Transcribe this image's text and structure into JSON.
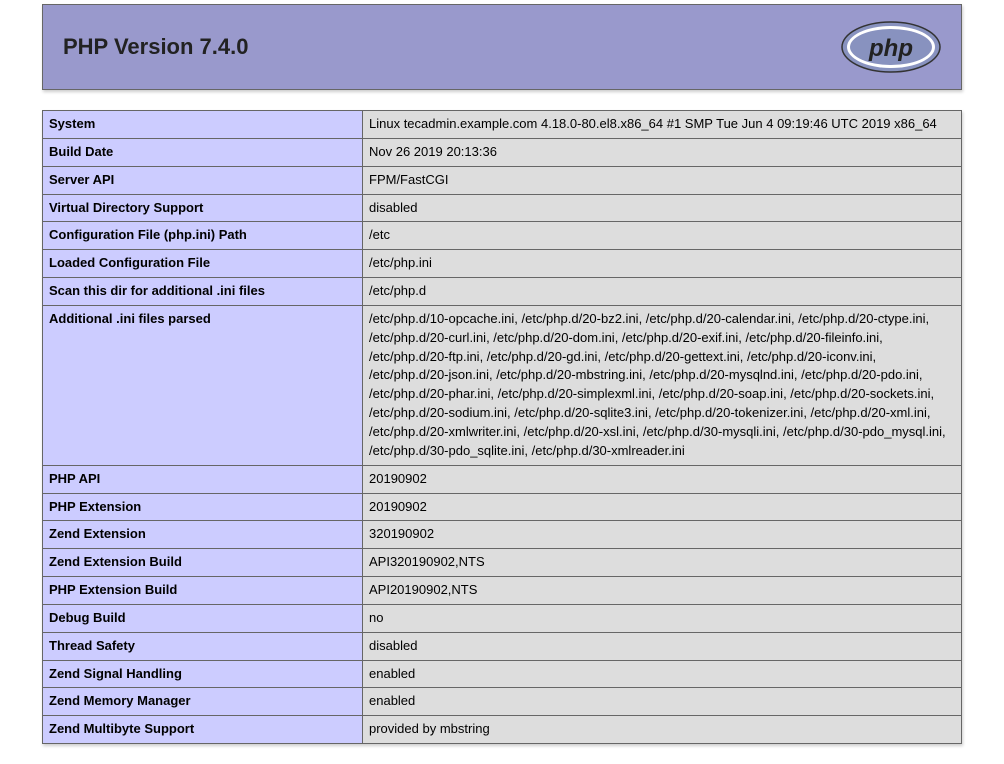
{
  "header": {
    "title": "PHP Version 7.4.0"
  },
  "rows": [
    {
      "label": "System",
      "value": "Linux tecadmin.example.com 4.18.0-80.el8.x86_64 #1 SMP Tue Jun 4 09:19:46 UTC 2019 x86_64"
    },
    {
      "label": "Build Date",
      "value": "Nov 26 2019 20:13:36"
    },
    {
      "label": "Server API",
      "value": "FPM/FastCGI"
    },
    {
      "label": "Virtual Directory Support",
      "value": "disabled"
    },
    {
      "label": "Configuration File (php.ini) Path",
      "value": "/etc"
    },
    {
      "label": "Loaded Configuration File",
      "value": "/etc/php.ini"
    },
    {
      "label": "Scan this dir for additional .ini files",
      "value": "/etc/php.d"
    },
    {
      "label": "Additional .ini files parsed",
      "value": "/etc/php.d/10-opcache.ini, /etc/php.d/20-bz2.ini, /etc/php.d/20-calendar.ini, /etc/php.d/20-ctype.ini, /etc/php.d/20-curl.ini, /etc/php.d/20-dom.ini, /etc/php.d/20-exif.ini, /etc/php.d/20-fileinfo.ini, /etc/php.d/20-ftp.ini, /etc/php.d/20-gd.ini, /etc/php.d/20-gettext.ini, /etc/php.d/20-iconv.ini, /etc/php.d/20-json.ini, /etc/php.d/20-mbstring.ini, /etc/php.d/20-mysqlnd.ini, /etc/php.d/20-pdo.ini, /etc/php.d/20-phar.ini, /etc/php.d/20-simplexml.ini, /etc/php.d/20-soap.ini, /etc/php.d/20-sockets.ini, /etc/php.d/20-sodium.ini, /etc/php.d/20-sqlite3.ini, /etc/php.d/20-tokenizer.ini, /etc/php.d/20-xml.ini, /etc/php.d/20-xmlwriter.ini, /etc/php.d/20-xsl.ini, /etc/php.d/30-mysqli.ini, /etc/php.d/30-pdo_mysql.ini, /etc/php.d/30-pdo_sqlite.ini, /etc/php.d/30-xmlreader.ini"
    },
    {
      "label": "PHP API",
      "value": "20190902"
    },
    {
      "label": "PHP Extension",
      "value": "20190902"
    },
    {
      "label": "Zend Extension",
      "value": "320190902"
    },
    {
      "label": "Zend Extension Build",
      "value": "API320190902,NTS"
    },
    {
      "label": "PHP Extension Build",
      "value": "API20190902,NTS"
    },
    {
      "label": "Debug Build",
      "value": "no"
    },
    {
      "label": "Thread Safety",
      "value": "disabled"
    },
    {
      "label": "Zend Signal Handling",
      "value": "enabled"
    },
    {
      "label": "Zend Memory Manager",
      "value": "enabled"
    },
    {
      "label": "Zend Multibyte Support",
      "value": "provided by mbstring"
    }
  ]
}
